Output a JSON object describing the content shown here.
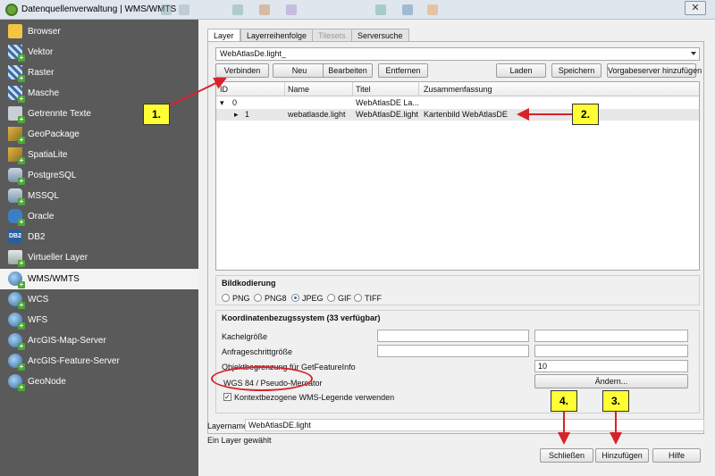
{
  "window": {
    "title": "Datenquellenverwaltung | WMS/WMTS",
    "close_symbol": "✕"
  },
  "sidebar": {
    "items": [
      {
        "label": "Browser",
        "icon": "folder-icon"
      },
      {
        "label": "Vektor",
        "icon": "vector-layer-icon"
      },
      {
        "label": "Raster",
        "icon": "raster-layer-icon"
      },
      {
        "label": "Masche",
        "icon": "mesh-layer-icon"
      },
      {
        "label": "Getrennte Texte",
        "icon": "delimited-text-icon"
      },
      {
        "label": "GeoPackage",
        "icon": "geopackage-icon"
      },
      {
        "label": "SpatiaLite",
        "icon": "spatialite-icon"
      },
      {
        "label": "PostgreSQL",
        "icon": "postgresql-icon"
      },
      {
        "label": "MSSQL",
        "icon": "mssql-icon"
      },
      {
        "label": "Oracle",
        "icon": "oracle-icon"
      },
      {
        "label": "DB2",
        "icon": "db2-icon"
      },
      {
        "label": "Virtueller Layer",
        "icon": "virtual-layer-icon"
      },
      {
        "label": "WMS/WMTS",
        "icon": "wms-globe-icon"
      },
      {
        "label": "WCS",
        "icon": "wcs-globe-icon"
      },
      {
        "label": "WFS",
        "icon": "wfs-globe-icon"
      },
      {
        "label": "ArcGIS-Map-Server",
        "icon": "arcgis-map-icon"
      },
      {
        "label": "ArcGIS-Feature-Server",
        "icon": "arcgis-feature-icon"
      },
      {
        "label": "GeoNode",
        "icon": "geonode-icon"
      }
    ],
    "selected": "WMS/WMTS",
    "db2_text": "DB2"
  },
  "tabs": [
    {
      "label": "Layer",
      "state": "active"
    },
    {
      "label": "Layerreihenfolge",
      "state": "normal"
    },
    {
      "label": "Tilesets",
      "state": "disabled"
    },
    {
      "label": "Serversuche",
      "state": "normal"
    }
  ],
  "connection": {
    "selected": "WebAtlasDe.light_",
    "buttons": {
      "connect": "Verbinden",
      "new": "Neu",
      "edit": "Bearbeiten",
      "remove": "Entfernen",
      "load": "Laden",
      "save": "Speichern",
      "add_default": "Vorgabeserver hinzufügen"
    }
  },
  "layer_tree": {
    "columns": [
      "ID",
      "Name",
      "Titel",
      "Zusammenfassung"
    ],
    "rows": [
      {
        "id": "0",
        "name": "",
        "title": "WebAtlasDE La...",
        "summary": ""
      },
      {
        "id": "1",
        "name": "webatlasde.light",
        "title": "WebAtlasDE.light",
        "summary": "Kartenbild WebAtlasDE"
      }
    ]
  },
  "encoding": {
    "title": "Bildkodierung",
    "options": [
      "PNG",
      "PNG8",
      "JPEG",
      "GIF",
      "TIFF"
    ],
    "selected": "JPEG"
  },
  "crs": {
    "title": "Koordinatenbezugssystem (33 verfügbar)",
    "tile_size_label": "Kachelgröße",
    "request_step_label": "Anfrageschrittgröße",
    "feature_limit_label": "Objektbegrenzung für GetFeatureInfo",
    "feature_limit_value": "10",
    "current": "WGS 84 / Pseudo-Mercator",
    "change_button": "Ändern...",
    "contextual_legend_label": "Kontextbezogene WMS-Legende verwenden",
    "contextual_legend_checked": true
  },
  "bottom": {
    "layername_label": "Layername",
    "layername_value": "WebAtlasDE.light",
    "status": "Ein Layer gewählt",
    "close": "Schließen",
    "add": "Hinzufügen",
    "help": "Hilfe"
  },
  "annotations": {
    "callouts": [
      "1.",
      "2.",
      "3.",
      "4."
    ],
    "color_callout": "#ffff33",
    "color_arrow": "#d6232a"
  }
}
